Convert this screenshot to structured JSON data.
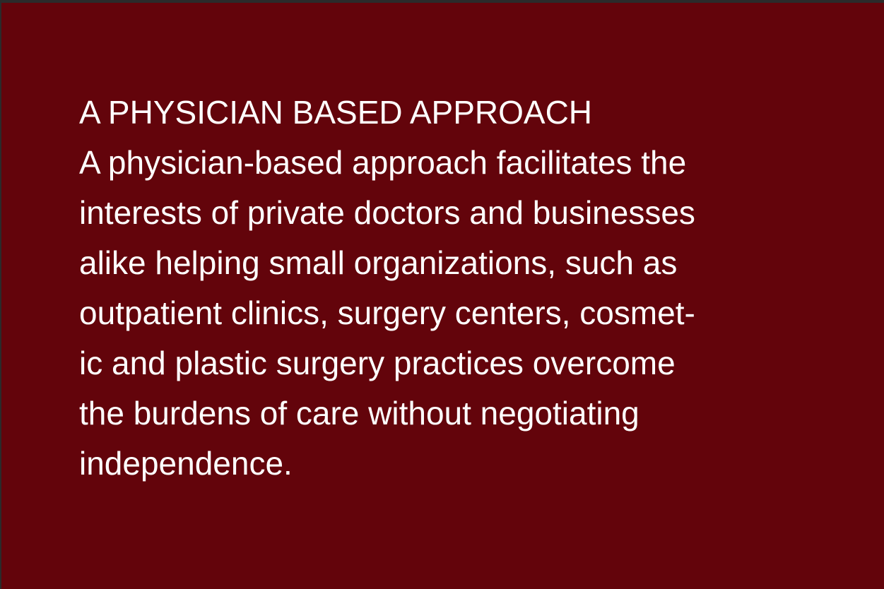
{
  "panel": {
    "background_color": "#63040b",
    "text_color": "#ffffff"
  },
  "heading": "A PHYSICIAN BASED APPROACH",
  "body_lines": [
    "A physician-based approach facilitates the",
    "interests of private doctors and businesses",
    "alike helping small organizations, such as",
    "outpatient clinics, surgery centers, cosmet-",
    "ic and plastic surgery practices overcome",
    "the burdens of care without negotiating",
    "independence."
  ]
}
